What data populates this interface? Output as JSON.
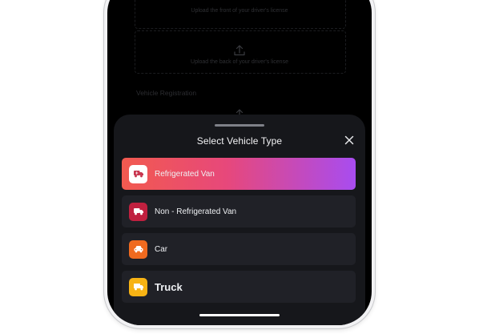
{
  "background": {
    "front_license_text": "Upload the front of your driver's license",
    "back_license_text": "Upload the back of your driver's license",
    "vehicle_registration_label": "Vehicle Registration"
  },
  "sheet": {
    "title": "Select Vehicle Type",
    "close_icon": "close-icon",
    "options": [
      {
        "label": "Refrigerated Van",
        "icon": "refrigerated-van-icon",
        "icon_bg": "#ffffff",
        "icon_color": "#c8364f",
        "selected": true
      },
      {
        "label": "Non - Refrigerated Van",
        "icon": "van-icon",
        "icon_bg": "#c0203f",
        "icon_color": "#ffffff",
        "selected": false
      },
      {
        "label": "Car",
        "icon": "car-icon",
        "icon_bg": "#ef6a1f",
        "icon_color": "#ffffff",
        "selected": false
      },
      {
        "label": "Truck",
        "icon": "truck-icon",
        "icon_bg": "#f7b314",
        "icon_color": "#ffffff",
        "selected": false
      }
    ]
  },
  "colors": {
    "selected_gradient_start": "#f25a4f",
    "selected_gradient_end": "#a84cf0",
    "sheet_bg": "#16171b",
    "option_bg": "#202127"
  }
}
